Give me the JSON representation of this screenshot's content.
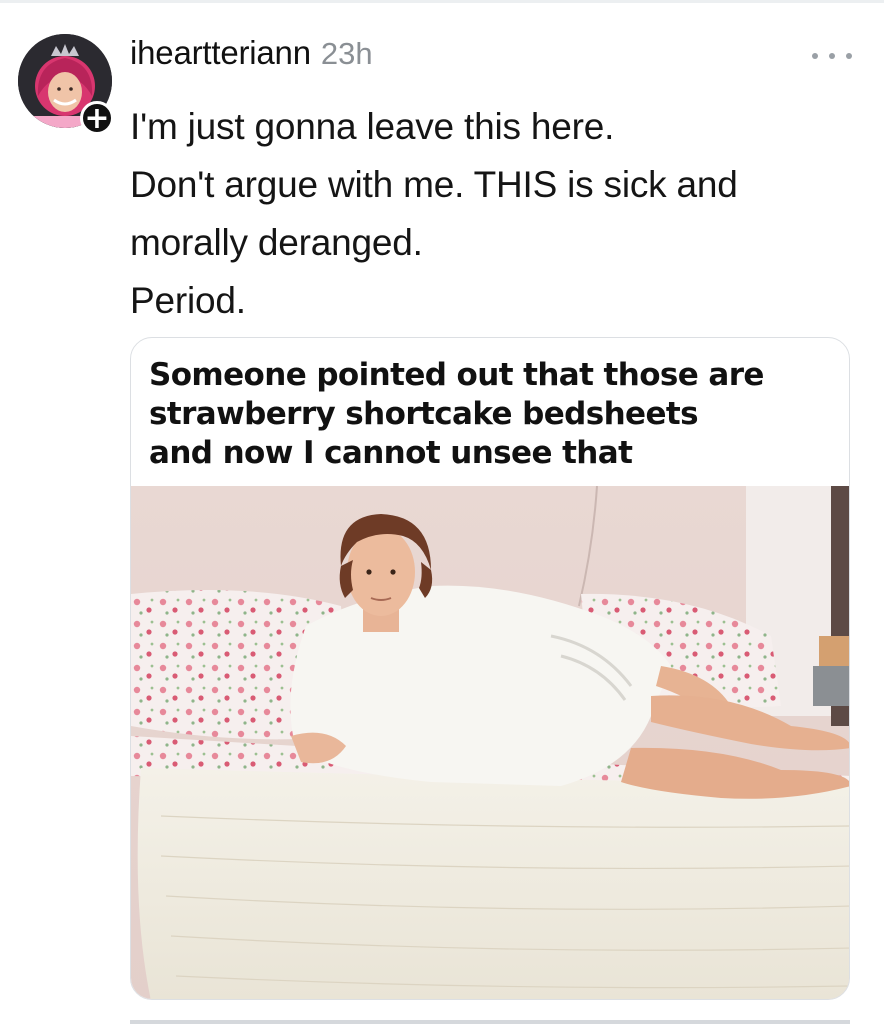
{
  "post": {
    "username": "iheartteriann",
    "timestamp": "23h",
    "follow_badge": "+",
    "text_lines": [
      "I'm just gonna leave this here.",
      "Don't argue with me. THIS is sick and",
      "morally deranged.",
      "Period."
    ]
  },
  "media": {
    "caption_lines": [
      "Someone pointed out that those are",
      "strawberry shortcake bedsheets",
      "and now I cannot unsee that"
    ]
  },
  "icons": {
    "more": "more-options-icon",
    "avatar": "user-avatar",
    "follow": "plus-icon"
  },
  "colors": {
    "text": "#151515",
    "muted": "#8a8f94",
    "border": "#dcdfe3"
  }
}
